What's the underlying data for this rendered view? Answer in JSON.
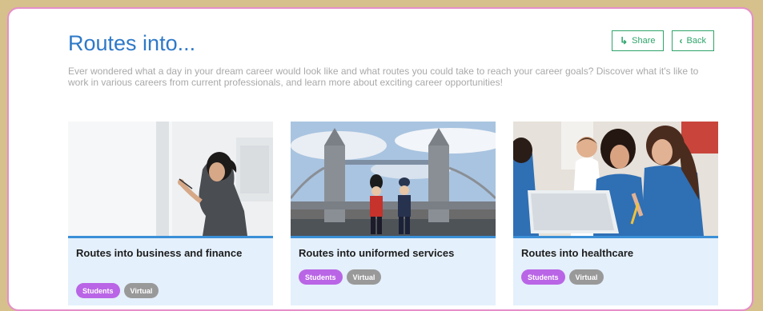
{
  "page": {
    "title": "Routes into...",
    "intro": "Ever wondered what a day in your dream career would look like and what routes you could take to reach your career goals? Discover what it's like to work in various careers from current professionals, and learn more about exciting career opportunities!"
  },
  "actions": {
    "share_label": "Share",
    "share_icon": "share-arrow-icon",
    "back_label": "Back",
    "back_icon": "chevron-left-icon"
  },
  "colors": {
    "accent": "#2e79c8",
    "button_green": "#2fa46a",
    "students_tag": "#b965e6",
    "virtual_tag": "#999999",
    "card_bg": "#e4f0fc"
  },
  "cards": [
    {
      "title": "Routes into business and finance",
      "tags": [
        "Students",
        "Virtual"
      ]
    },
    {
      "title": "Routes into uniformed services",
      "tags": [
        "Students",
        "Virtual"
      ]
    },
    {
      "title": "Routes into healthcare",
      "tags": [
        "Students",
        "Virtual"
      ]
    }
  ]
}
